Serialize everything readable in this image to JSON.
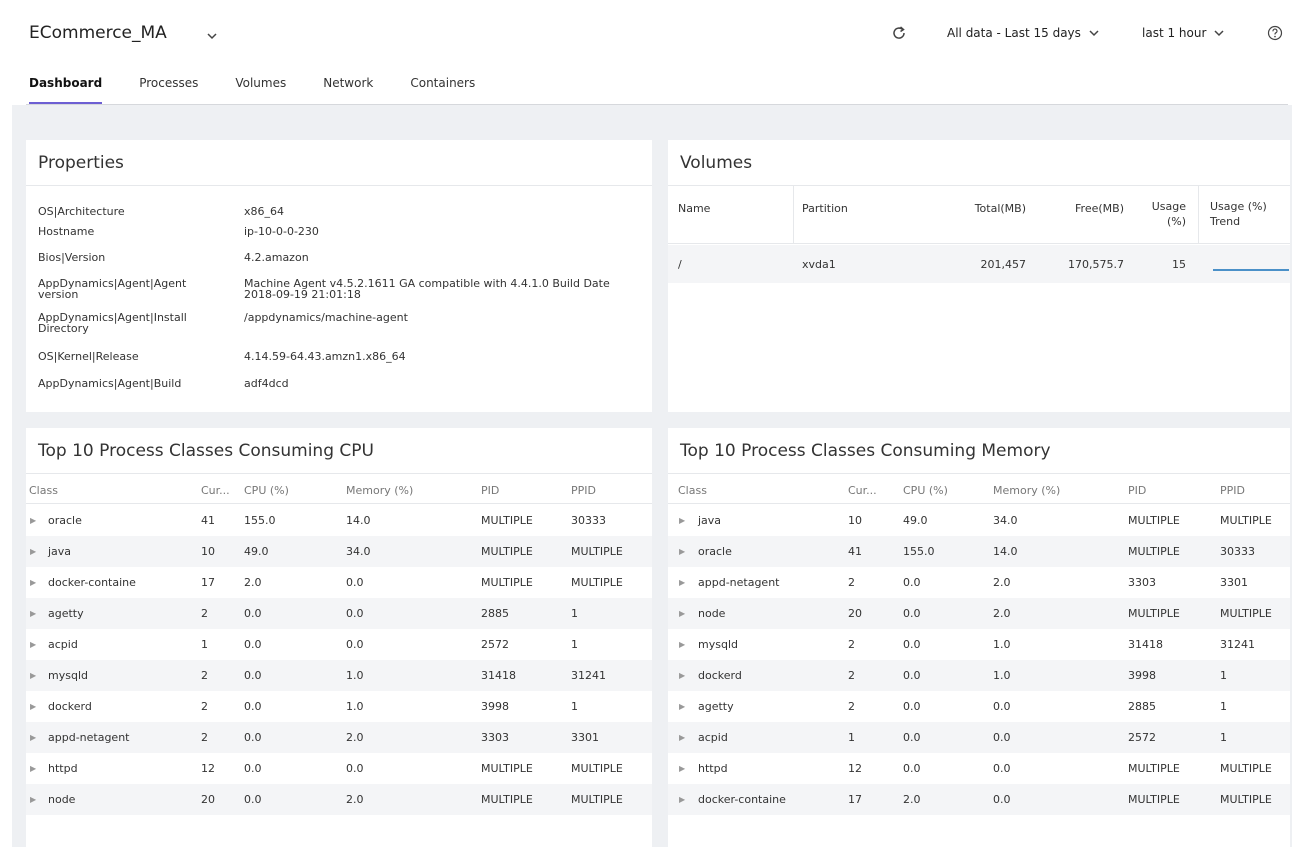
{
  "header": {
    "app_title": "ECommerce_MA",
    "data_range": "All data - Last 15 days",
    "time_range": "last 1 hour"
  },
  "tabs": [
    "Dashboard",
    "Processes",
    "Volumes",
    "Network",
    "Containers"
  ],
  "properties": {
    "title": "Properties",
    "rows": [
      {
        "key": "OS|Architecture",
        "value": "x86_64"
      },
      {
        "key": "Hostname",
        "value": "ip-10-0-0-230"
      },
      {
        "key": "Bios|Version",
        "value": "4.2.amazon"
      },
      {
        "key": "AppDynamics|Agent|Agent version",
        "value": "Machine Agent v4.5.2.1611 GA compatible with 4.4.1.0 Build Date 2018-09-19 21:01:18"
      },
      {
        "key": "AppDynamics|Agent|Install Directory",
        "value": "/appdynamics/machine-agent"
      },
      {
        "key": "OS|Kernel|Release",
        "value": "4.14.59-64.43.amzn1.x86_64"
      },
      {
        "key": "AppDynamics|Agent|Build",
        "value": "adf4dcd"
      }
    ]
  },
  "volumes": {
    "title": "Volumes",
    "headers": {
      "name": "Name",
      "partition": "Partition",
      "total": "Total(MB)",
      "free": "Free(MB)",
      "usage_1": "Usage",
      "usage_2": "(%)",
      "trend_1": "Usage (%)",
      "trend_2": "Trend"
    },
    "rows": [
      {
        "name": "/",
        "partition": "xvda1",
        "total": "201,457",
        "free": "170,575.7",
        "usage": "15"
      }
    ]
  },
  "cpu": {
    "title": "Top 10 Process Classes Consuming CPU",
    "headers": [
      "Class",
      "Cur...",
      "CPU (%)",
      "Memory (%)",
      "PID",
      "PPID"
    ],
    "rows": [
      [
        "oracle",
        "41",
        "155.0",
        "14.0",
        "MULTIPLE",
        "30333"
      ],
      [
        "java",
        "10",
        "49.0",
        "34.0",
        "MULTIPLE",
        "MULTIPLE"
      ],
      [
        "docker-containe",
        "17",
        "2.0",
        "0.0",
        "MULTIPLE",
        "MULTIPLE"
      ],
      [
        "agetty",
        "2",
        "0.0",
        "0.0",
        "2885",
        "1"
      ],
      [
        "acpid",
        "1",
        "0.0",
        "0.0",
        "2572",
        "1"
      ],
      [
        "mysqld",
        "2",
        "0.0",
        "1.0",
        "31418",
        "31241"
      ],
      [
        "dockerd",
        "2",
        "0.0",
        "1.0",
        "3998",
        "1"
      ],
      [
        "appd-netagent",
        "2",
        "0.0",
        "2.0",
        "3303",
        "3301"
      ],
      [
        "httpd",
        "12",
        "0.0",
        "0.0",
        "MULTIPLE",
        "MULTIPLE"
      ],
      [
        "node",
        "20",
        "0.0",
        "2.0",
        "MULTIPLE",
        "MULTIPLE"
      ]
    ]
  },
  "memory": {
    "title": "Top 10 Process Classes Consuming Memory",
    "headers": [
      "Class",
      "Cur...",
      "CPU (%)",
      "Memory (%)",
      "PID",
      "PPID"
    ],
    "rows": [
      [
        "java",
        "10",
        "49.0",
        "34.0",
        "MULTIPLE",
        "MULTIPLE"
      ],
      [
        "oracle",
        "41",
        "155.0",
        "14.0",
        "MULTIPLE",
        "30333"
      ],
      [
        "appd-netagent",
        "2",
        "0.0",
        "2.0",
        "3303",
        "3301"
      ],
      [
        "node",
        "20",
        "0.0",
        "2.0",
        "MULTIPLE",
        "MULTIPLE"
      ],
      [
        "mysqld",
        "2",
        "0.0",
        "1.0",
        "31418",
        "31241"
      ],
      [
        "dockerd",
        "2",
        "0.0",
        "1.0",
        "3998",
        "1"
      ],
      [
        "agetty",
        "2",
        "0.0",
        "0.0",
        "2885",
        "1"
      ],
      [
        "acpid",
        "1",
        "0.0",
        "0.0",
        "2572",
        "1"
      ],
      [
        "httpd",
        "12",
        "0.0",
        "0.0",
        "MULTIPLE",
        "MULTIPLE"
      ],
      [
        "docker-containe",
        "17",
        "2.0",
        "0.0",
        "MULTIPLE",
        "MULTIPLE"
      ]
    ]
  },
  "colors": {
    "accent": "#6d5fd3",
    "trend_line": "#4a90c8",
    "row_alt": "#f4f5f7"
  },
  "icons": [
    "chevron-down-icon",
    "refresh-icon",
    "help-icon",
    "expand-caret-icon"
  ]
}
